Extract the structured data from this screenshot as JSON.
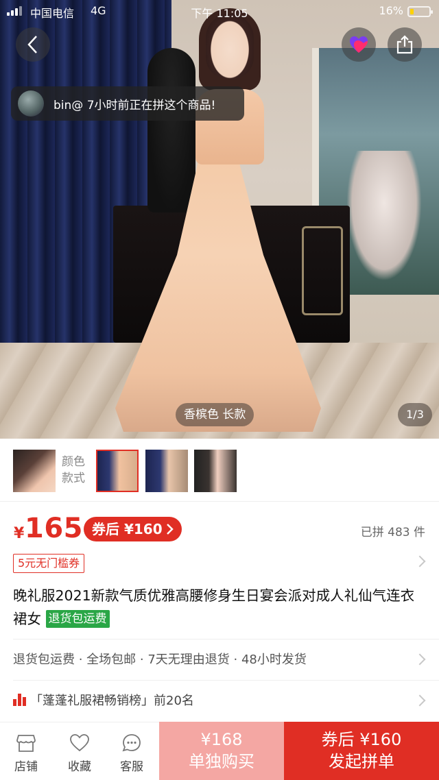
{
  "status_bar": {
    "carrier": "中国电信",
    "network": "4G",
    "time": "下午 11:05",
    "battery_percent": "16%"
  },
  "toast": {
    "text": "bin@ 7小时前正在拼这个商品!"
  },
  "gallery": {
    "variant_label": "香槟色 长款",
    "counter": "1/3",
    "thumb_label": "颜色款式",
    "selected_index": 1
  },
  "price": {
    "currency": "¥",
    "amount": "165",
    "coupon_after": "券后 ¥160",
    "sold": "已拼 483 件"
  },
  "coupon_tag": "5元无门槛券",
  "product": {
    "title": "晚礼服2021新款气质优雅高腰修身生日宴会派对成人礼仙气连衣裙女",
    "badge": "退货包运费"
  },
  "services": "退货包运费 · 全场包邮 · 7天无理由退货 · 48小时发货",
  "rank": "「蓬蓬礼服裙畅销榜」前20名",
  "bottom_bar": {
    "store": "店铺",
    "favorite": "收藏",
    "service": "客服",
    "solo_price": "¥168",
    "solo_label": "单独购买",
    "group_price": "券后 ¥160",
    "group_label": "发起拼单"
  },
  "colors": {
    "brand_red": "#e02e24",
    "solo_button": "#f4a7a3",
    "badge_green": "#2aa646"
  },
  "icons": [
    "back-icon",
    "favorite-heart-icon",
    "share-icon",
    "chevron-right-icon",
    "store-icon",
    "heart-outline-icon",
    "chat-icon",
    "rank-bars-icon"
  ]
}
